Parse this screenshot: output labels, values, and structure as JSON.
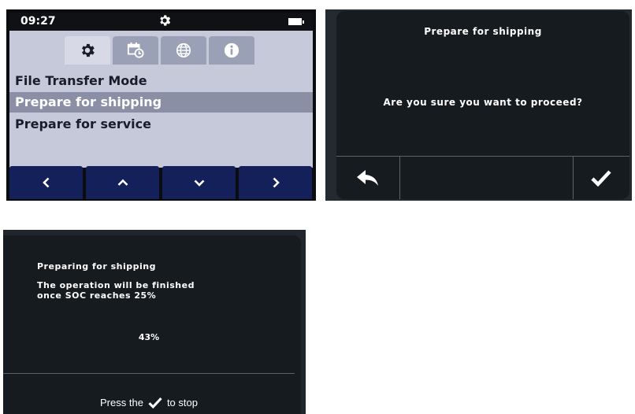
{
  "settings_screen": {
    "status": {
      "time": "09:27"
    },
    "tabs": [
      {
        "name": "settings",
        "icon": "gear-icon",
        "active": true
      },
      {
        "name": "calendar-clock",
        "icon": "calendar-clock-icon",
        "active": false
      },
      {
        "name": "globe",
        "icon": "globe-icon",
        "active": false
      },
      {
        "name": "info",
        "icon": "info-icon",
        "active": false
      }
    ],
    "menu": [
      {
        "label": "File Transfer Mode",
        "selected": false
      },
      {
        "label": "Prepare for shipping",
        "selected": true
      },
      {
        "label": "Prepare for service",
        "selected": false
      }
    ],
    "nav_buttons": [
      "chevron-left-icon",
      "chevron-up-icon",
      "chevron-down-icon",
      "chevron-right-icon"
    ]
  },
  "confirm_dialog": {
    "title": "Prepare for shipping",
    "message": "Are you sure you want to proceed?",
    "buttons": [
      "back-arrow-icon",
      "checkmark-icon"
    ]
  },
  "progress_dialog": {
    "title": "Preparing for shipping",
    "message_line1": "The operation will be finished",
    "message_line2": "once SOC reaches 25%",
    "progress": "43%",
    "footer_prefix": "Press the",
    "footer_suffix": "to stop",
    "footer_icon": "checkmark-icon"
  },
  "colors": {
    "menu_panel": "#c6c9da",
    "menu_selected": "#8b8fa6",
    "nav_button": "#13205a",
    "dialog_bg": "#161b1f"
  }
}
